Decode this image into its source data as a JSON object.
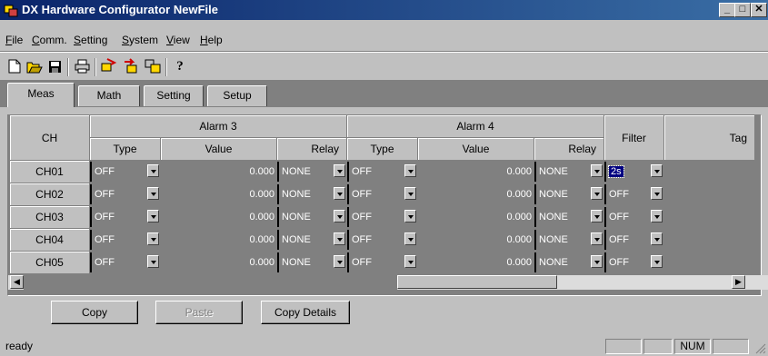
{
  "window": {
    "title": "DX Hardware Configurator NewFile"
  },
  "menu": [
    "File",
    "Comm.",
    "Setting",
    "System",
    "View",
    "Help"
  ],
  "toolbar": {
    "help_glyph": "?"
  },
  "tabs": [
    {
      "label": "Meas",
      "active": true
    },
    {
      "label": "Math",
      "active": false
    },
    {
      "label": "Setting",
      "active": false
    },
    {
      "label": "Setup",
      "active": false
    }
  ],
  "grid": {
    "header": {
      "ch": "CH",
      "alarm3": "Alarm 3",
      "alarm4": "Alarm 4",
      "type": "Type",
      "value": "Value",
      "relay": "Relay",
      "filter": "Filter",
      "tag": "Tag"
    },
    "rows": [
      {
        "ch": "CH01",
        "a3_type": "OFF",
        "a3_value": "0.000",
        "a3_relay": "NONE",
        "a4_type": "OFF",
        "a4_value": "0.000",
        "a4_relay": "NONE",
        "filter": "2s",
        "tag": ""
      },
      {
        "ch": "CH02",
        "a3_type": "OFF",
        "a3_value": "0.000",
        "a3_relay": "NONE",
        "a4_type": "OFF",
        "a4_value": "0.000",
        "a4_relay": "NONE",
        "filter": "OFF",
        "tag": ""
      },
      {
        "ch": "CH03",
        "a3_type": "OFF",
        "a3_value": "0.000",
        "a3_relay": "NONE",
        "a4_type": "OFF",
        "a4_value": "0.000",
        "a4_relay": "NONE",
        "filter": "OFF",
        "tag": ""
      },
      {
        "ch": "CH04",
        "a3_type": "OFF",
        "a3_value": "0.000",
        "a3_relay": "NONE",
        "a4_type": "OFF",
        "a4_value": "0.000",
        "a4_relay": "NONE",
        "filter": "OFF",
        "tag": ""
      },
      {
        "ch": "CH05",
        "a3_type": "OFF",
        "a3_value": "0.000",
        "a3_relay": "NONE",
        "a4_type": "OFF",
        "a4_value": "0.000",
        "a4_relay": "NONE",
        "filter": "OFF",
        "tag": ""
      }
    ]
  },
  "buttons": {
    "copy": "Copy",
    "paste": "Paste",
    "copy_details": "Copy Details"
  },
  "status": {
    "text": "ready",
    "num": "NUM"
  },
  "colors": {
    "title_start": "#0a246a",
    "title_end": "#3a6ea5",
    "face": "#c0c0c0",
    "grid_bg": "#808080",
    "selection": "#000080"
  }
}
